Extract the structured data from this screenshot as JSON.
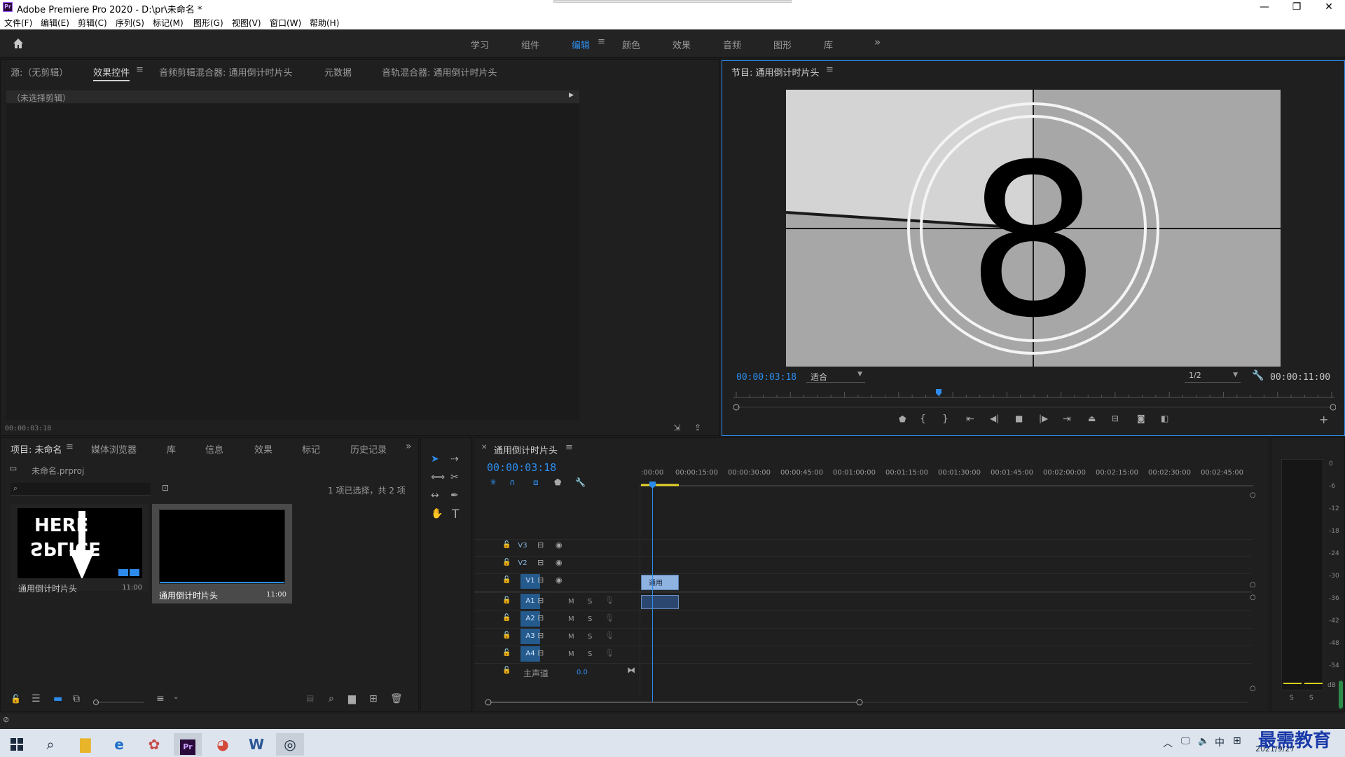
{
  "window": {
    "title": "Adobe Premiere Pro 2020 - D:\\pr\\未命名 *",
    "logo": "Pr"
  },
  "window_controls": {
    "minimize": "—",
    "restore": "❐",
    "close": "✕"
  },
  "menu": [
    "文件(F)",
    "编辑(E)",
    "剪辑(C)",
    "序列(S)",
    "标记(M)",
    "图形(G)",
    "视图(V)",
    "窗口(W)",
    "帮助(H)"
  ],
  "workspaces": {
    "items": [
      "学习",
      "组件",
      "编辑",
      "颜色",
      "效果",
      "音频",
      "图形",
      "库"
    ],
    "active": "编辑",
    "more": "»"
  },
  "source_panel": {
    "tabs": [
      "源:（无剪辑）",
      "效果控件",
      "音频剪辑混合器: 通用倒计时片头",
      "元数据",
      "音轨混合器: 通用倒计时片头"
    ],
    "active_tab": "效果控件",
    "no_clip": "（未选择剪辑）",
    "timecode": "00:00:03:18"
  },
  "program_monitor": {
    "title": "节目: 通用倒计时片头",
    "countdown_number": "8",
    "timecode": "00:00:03:18",
    "fit": "适合",
    "resolution": "1/2",
    "duration": "00:00:11:00",
    "playhead_fraction": 0.34
  },
  "project_panel": {
    "tabs": [
      "项目: 未命名",
      "媒体浏览器",
      "库",
      "信息",
      "效果",
      "标记",
      "历史记录"
    ],
    "active_tab": "项目: 未命名",
    "file": "未命名.prproj",
    "selection": "1 项已选择，共 2 项",
    "items": [
      {
        "name": "通用倒计时片头",
        "duration": "11:00",
        "thumb_line1": "HERE",
        "thumb_line2": "SPLICE"
      },
      {
        "name": "通用倒计时片头",
        "duration": "11:00"
      }
    ]
  },
  "timeline": {
    "sequence_name": "通用倒计时片头",
    "timecode": "00:00:03:18",
    "ruler": [
      ":00:00",
      "00:00:15:00",
      "00:00:30:00",
      "00:00:45:00",
      "00:01:00:00",
      "00:01:15:00",
      "00:01:30:00",
      "00:01:45:00",
      "00:02:00:00",
      "00:02:15:00",
      "00:02:30:00",
      "00:02:45:00"
    ],
    "video_tracks": [
      "V3",
      "V2",
      "V1"
    ],
    "audio_tracks": [
      "A1",
      "A2",
      "A3",
      "A4"
    ],
    "mute": "M",
    "solo": "S",
    "master": "主声道",
    "master_value": "0.0",
    "clip_label": "通用"
  },
  "audio_meter": {
    "scale": [
      "0",
      "-6",
      "-12",
      "-18",
      "-24",
      "-30",
      "-36",
      "-42",
      "-48",
      "-54",
      "dB"
    ],
    "solo_left": "S",
    "solo_right": "S"
  },
  "taskbar": {
    "ime": "中",
    "date": "2021/9/27",
    "watermark": "最需教育"
  },
  "colors": {
    "accent": "#2d8ceb",
    "panel": "#1f1f1f",
    "track_selected": "#245a8c"
  }
}
